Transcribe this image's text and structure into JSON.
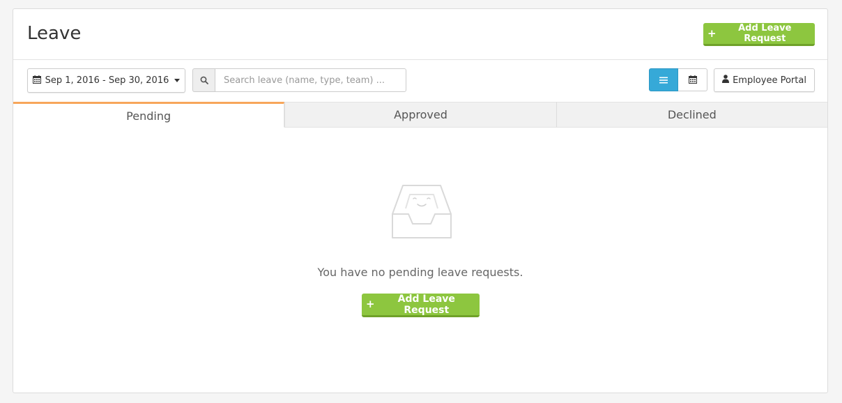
{
  "header": {
    "title": "Leave",
    "add_button_label": "Add Leave Request"
  },
  "toolbar": {
    "date_range": "Sep 1, 2016 - Sep 30, 2016",
    "search_placeholder": "Search leave (name, type, team) ...",
    "search_value": "",
    "view_mode": "list",
    "employee_portal_label": "Employee Portal"
  },
  "tabs": [
    {
      "label": "Pending",
      "active": true
    },
    {
      "label": "Approved",
      "active": false
    },
    {
      "label": "Declined",
      "active": false
    }
  ],
  "empty_state": {
    "message": "You have no pending leave requests.",
    "button_label": "Add Leave Request"
  },
  "colors": {
    "accent_green": "#8dc63f",
    "accent_blue": "#36a9d8",
    "active_tab_border": "#f7a65a"
  },
  "icons": {
    "plus": "plus-icon",
    "calendar": "calendar-icon",
    "search": "search-icon",
    "list": "list-icon",
    "user": "user-icon",
    "inbox": "inbox-icon"
  }
}
